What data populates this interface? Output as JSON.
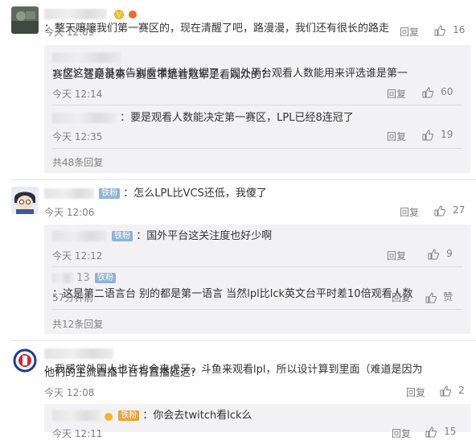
{
  "comments": [
    {
      "name": "",
      "text": "：整天嚷嚷我们第一赛区的，现在清醒了吧，路漫漫，我们还有很长的路走",
      "time": "今天 12:09",
      "reply_label": "回复",
      "likes": "16",
      "replies": [
        {
          "line1": "：您这智商基本告别看懂统计数据了，国外平台观看人数能用来评选谁是第一",
          "line2": "赛区？还是说第一赛区不是看冠军是看观众的？",
          "time": "今天 12:14",
          "reply_label": "回复",
          "likes": "60"
        },
        {
          "line1": "：要是观看人数能决定第一赛区，LPL已经8连冠了",
          "time": "今天 12:35",
          "reply_label": "回复",
          "likes": "19"
        }
      ],
      "more": "共48条回复"
    },
    {
      "badge": "铁粉",
      "text": "：怎么LPL比VCS还低，我傻了",
      "time": "今天 12:06",
      "reply_label": "回复",
      "likes": "27",
      "replies": [
        {
          "badge": "铁粉",
          "line1": "：国外平台这关注度也好少啊",
          "time": "今天 12:12",
          "reply_label": "回复",
          "likes": "9"
        },
        {
          "name_suffix": "13",
          "badge": "铁粉",
          "line1": "：这是第二语言台 别的都是第一语言 当然lpl比lck英文台平时差10倍观看人数",
          "time": "57分钟前",
          "reply_label": "回复",
          "likes": "赞"
        }
      ],
      "more": "共12条回复"
    },
    {
      "line1": "：我感觉外国人也许也会来虎牙，斗鱼来观看lpl，所以设计算到里面（难道是因为",
      "line2": "他们的主流直播平台有直播延迟？",
      "time": "今天 12:08",
      "reply_label": "回复",
      "likes": "2",
      "replies": [
        {
          "badge": "铁粉",
          "line1": "：你会去twitch看lck么",
          "time": "今天 12:11",
          "reply_label": "回复",
          "likes": "15"
        }
      ]
    }
  ],
  "colors": {
    "link": "#eb7350",
    "badge": "#8fb5d6",
    "badge_gold": "#e9a43a",
    "reply_bg": "#f2f2f5"
  }
}
